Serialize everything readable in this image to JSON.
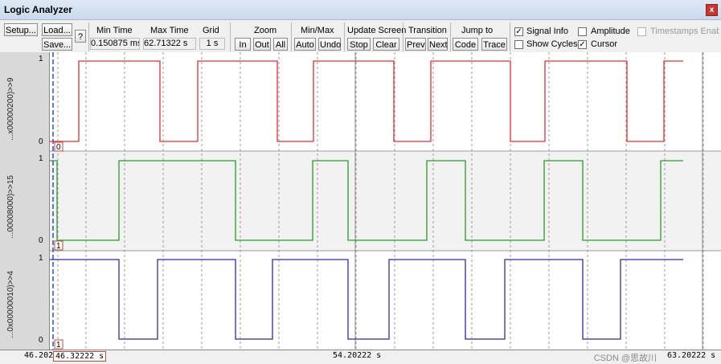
{
  "window": {
    "title": "Logic Analyzer",
    "close": "x"
  },
  "toolbar": {
    "setup": "Setup...",
    "load": "Load...",
    "save": "Save...",
    "help": "?",
    "min_time_label": "Min Time",
    "min_time_value": "0.150875 ms",
    "max_time_label": "Max Time",
    "max_time_value": "62.71322 s",
    "grid_label": "Grid",
    "grid_value": "1 s",
    "zoom_label": "Zoom",
    "zoom_in": "In",
    "zoom_out": "Out",
    "zoom_all": "All",
    "minmax_label": "Min/Max",
    "auto": "Auto",
    "undo": "Undo",
    "update_label": "Update Screen",
    "stop": "Stop",
    "clear": "Clear",
    "transition_label": "Transition",
    "prev": "Prev",
    "next": "Next",
    "jump_label": "Jump to",
    "code": "Code",
    "trace": "Trace",
    "signal_info": "Signal Info",
    "show_cycles": "Show Cycles",
    "amplitude": "Amplitude",
    "cursor": "Cursor",
    "timestamps": "Timestamps Enabl"
  },
  "checkboxes": {
    "signal_info": true,
    "show_cycles": false,
    "amplitude": false,
    "cursor": true,
    "timestamps": false
  },
  "signals": [
    {
      "name": "...x00000200)>>9",
      "color": "#e03030",
      "high": "1",
      "low": "0",
      "cursor_value": "0",
      "edges": [
        0,
        36,
        137,
        184,
        283,
        328,
        428,
        474,
        573,
        616,
        718,
        764,
        788
      ],
      "start_high": false
    },
    {
      "name": "...00008000)>>15",
      "color": "#2a9a2a",
      "high": "1",
      "low": "0",
      "cursor_value": "1",
      "edges": [
        0,
        9,
        86,
        231,
        327,
        371,
        469,
        517,
        615,
        663,
        760,
        788
      ],
      "start_high": true
    },
    {
      "name": "...0x00000010)>>4",
      "color": "#2b2ba8",
      "high": "1",
      "low": "0",
      "cursor_value": "1",
      "edges": [
        0,
        86,
        134,
        231,
        277,
        371,
        422,
        517,
        566,
        663,
        710,
        788
      ],
      "start_high": true
    }
  ],
  "timebar": {
    "left": "46.20222",
    "cursor": "46.32222  s",
    "center": "54.20222  s",
    "right": "63.20222  s",
    "watermark": "CSDN @思故川"
  }
}
